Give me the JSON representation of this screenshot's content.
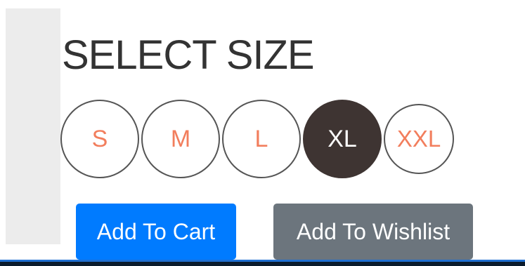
{
  "title": "SELECT SIZE",
  "sizes": {
    "options": [
      {
        "label": "S",
        "selected": false
      },
      {
        "label": "M",
        "selected": false
      },
      {
        "label": "L",
        "selected": false
      },
      {
        "label": "XL",
        "selected": true
      },
      {
        "label": "XXL",
        "selected": false
      }
    ],
    "selected": "XL"
  },
  "actions": {
    "add_to_cart": "Add To Cart",
    "add_to_wishlist": "Add To Wishlist"
  },
  "colors": {
    "size_text": "#f27e5d",
    "selected_bg": "#3e3432",
    "cart_button": "#007bff",
    "wishlist_button": "#6c757d"
  }
}
